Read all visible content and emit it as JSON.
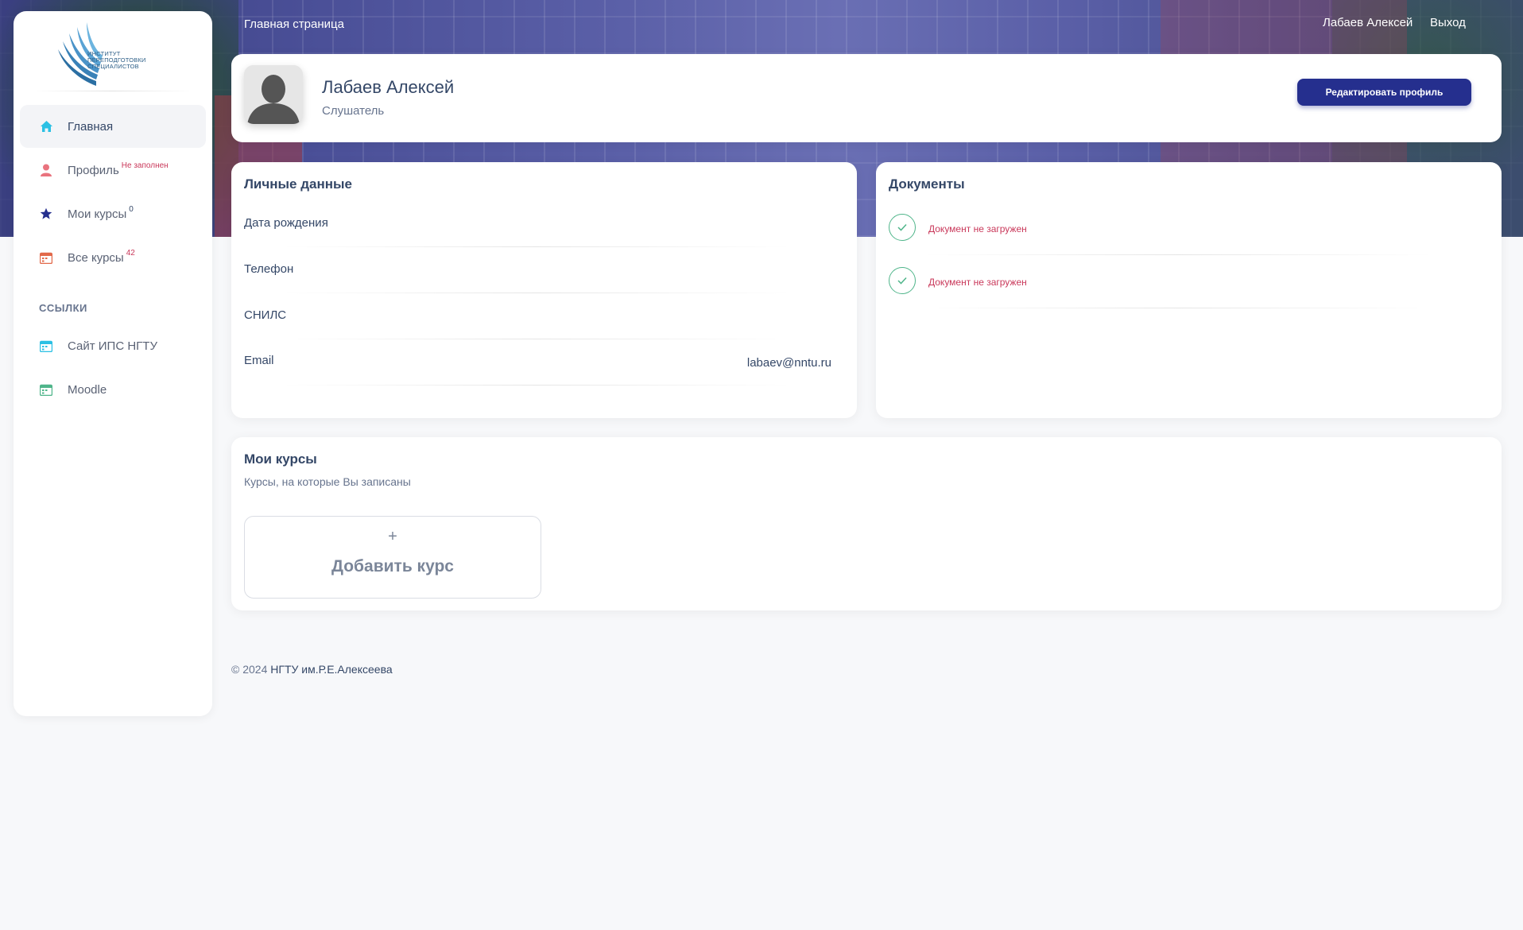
{
  "topbar": {
    "breadcrumb": "Главная страница",
    "user_name": "Лабаев Алексей",
    "logout": "Выход"
  },
  "logo": {
    "lines": [
      "ИНСТИТУТ",
      "ПЕРЕПОДГОТОВКИ",
      "СПЕЦИАЛИСТОВ"
    ]
  },
  "sidebar": {
    "items": [
      {
        "label": "Главная",
        "icon": "home-icon",
        "badge": ""
      },
      {
        "label": "Профиль",
        "icon": "user-icon",
        "badge": "Не заполнен"
      },
      {
        "label": "Мои курсы",
        "icon": "star-icon",
        "badge": "0"
      },
      {
        "label": "Все курсы",
        "icon": "calendar-icon",
        "badge": "42"
      }
    ],
    "links_title": "ССЫЛКИ",
    "links": [
      {
        "label": "Сайт ИПС НГТУ",
        "icon": "calendar-icon"
      },
      {
        "label": "Moodle",
        "icon": "calendar-icon"
      }
    ]
  },
  "profile": {
    "name": "Лабаев Алексей",
    "role": "Слушатель",
    "edit_button": "Редактировать профиль"
  },
  "personal": {
    "title": "Личные данные",
    "fields": [
      {
        "label": "Дата рождения",
        "value": ""
      },
      {
        "label": "Телефон",
        "value": ""
      },
      {
        "label": "СНИЛС",
        "value": ""
      },
      {
        "label": "Email",
        "value": "labaev@nntu.ru"
      }
    ]
  },
  "documents": {
    "title": "Документы",
    "items": [
      {
        "status": "Документ не загружен"
      },
      {
        "status": "Документ не загружен"
      }
    ]
  },
  "courses": {
    "title": "Мои курсы",
    "subtitle": "Курсы, на которые Вы записаны",
    "add_plus": "+",
    "add_label": "Добавить курс"
  },
  "footer": {
    "copyright": "© 2024",
    "org": "НГТУ им.Р.Е.Алексеева"
  },
  "colors": {
    "accent": "#252f8e",
    "warning": "#c9385a",
    "success": "#4fb58a",
    "home_icon": "#2bc0e4",
    "user_icon": "#e9737e",
    "star_icon": "#252f8e",
    "calendar_icon": "#e2694a"
  }
}
